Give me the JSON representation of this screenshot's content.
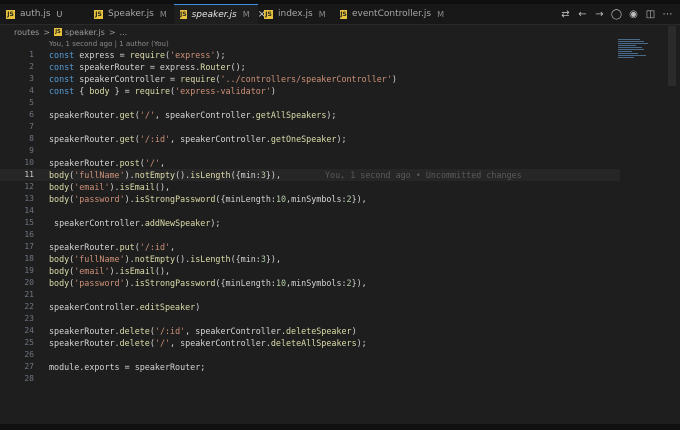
{
  "tabs": [
    {
      "label": "auth.js",
      "status": "U",
      "active": false
    },
    {
      "label": "Speaker.js",
      "status": "M",
      "active": false
    },
    {
      "label": "speaker.js",
      "status": "M",
      "active": true
    },
    {
      "label": "index.js",
      "status": "M",
      "active": false
    },
    {
      "label": "eventController.js",
      "status": "M",
      "active": false
    }
  ],
  "close_glyph": "×",
  "file_icon": "JS",
  "breadcrumb": {
    "folder": "routes",
    "sep": ">",
    "file": "speaker.js",
    "more": "..."
  },
  "blame": "You, 1 second ago | 1 author (You)",
  "inline_blame": "You, 1 second ago • Uncommitted changes",
  "cursor_line": 11,
  "lines": [
    {
      "n": 1,
      "t": "const express = require('express');"
    },
    {
      "n": 2,
      "t": "const speakerRouter = express.Router();"
    },
    {
      "n": 3,
      "t": "const speakerController = require('../controllers/speakerController')"
    },
    {
      "n": 4,
      "t": "const { body } = require('express-validator')"
    },
    {
      "n": 5,
      "t": ""
    },
    {
      "n": 6,
      "t": "speakerRouter.get('/', speakerController.getAllSpeakers);"
    },
    {
      "n": 7,
      "t": ""
    },
    {
      "n": 8,
      "t": "speakerRouter.get('/:id', speakerController.getOneSpeaker);"
    },
    {
      "n": 9,
      "t": ""
    },
    {
      "n": 10,
      "t": "speakerRouter.post('/',"
    },
    {
      "n": 11,
      "t": "body('fullName').notEmpty().isLength({min:3}),"
    },
    {
      "n": 12,
      "t": "body('email').isEmail(),"
    },
    {
      "n": 13,
      "t": "body('password').isStrongPassword({minLength:10,minSymbols:2}),"
    },
    {
      "n": 14,
      "t": ""
    },
    {
      "n": 15,
      "t": " speakerController.addNewSpeaker);"
    },
    {
      "n": 16,
      "t": ""
    },
    {
      "n": 17,
      "t": "speakerRouter.put('/:id',"
    },
    {
      "n": 18,
      "t": "body('fullName').notEmpty().isLength({min:3}),"
    },
    {
      "n": 19,
      "t": "body('email').isEmail(),"
    },
    {
      "n": 20,
      "t": "body('password').isStrongPassword({minLength:10,minSymbols:2}),"
    },
    {
      "n": 21,
      "t": ""
    },
    {
      "n": 22,
      "t": "speakerController.editSpeaker)"
    },
    {
      "n": 23,
      "t": ""
    },
    {
      "n": 24,
      "t": "speakerRouter.delete('/:id', speakerController.deleteSpeaker)"
    },
    {
      "n": 25,
      "t": "speakerRouter.delete('/', speakerController.deleteAllSpeakers);"
    },
    {
      "n": 26,
      "t": ""
    },
    {
      "n": 27,
      "t": "module.exports = speakerRouter;"
    },
    {
      "n": 28,
      "t": ""
    }
  ],
  "colors": {
    "keyword": "#569cd6",
    "string": "#ce9178",
    "function": "#dcdcaa",
    "number": "#b5cea8",
    "accent": "#3a8ee6"
  },
  "toolbar_icons": [
    "compare-icon",
    "go-back-icon",
    "go-forward-icon",
    "circle-dot-icon",
    "github-icon",
    "split-editor-icon",
    "more-icon"
  ]
}
